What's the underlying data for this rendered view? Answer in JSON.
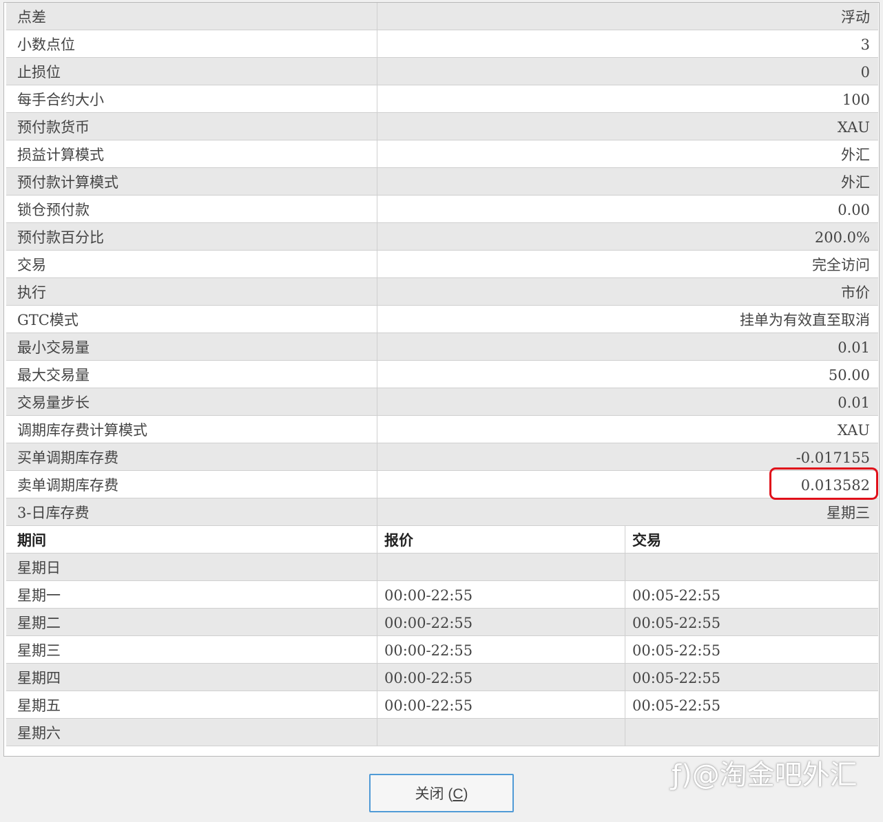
{
  "spec_rows": [
    {
      "label": "点差",
      "value": "浮动"
    },
    {
      "label": "小数点位",
      "value": "3"
    },
    {
      "label": "止损位",
      "value": "0"
    },
    {
      "label": "每手合约大小",
      "value": "100"
    },
    {
      "label": "预付款货币",
      "value": "XAU"
    },
    {
      "label": "损益计算模式",
      "value": "外汇"
    },
    {
      "label": "预付款计算模式",
      "value": "外汇"
    },
    {
      "label": "锁仓预付款",
      "value": "0.00"
    },
    {
      "label": "预付款百分比",
      "value": "200.0%"
    },
    {
      "label": "交易",
      "value": "完全访问"
    },
    {
      "label": "执行",
      "value": "市价"
    },
    {
      "label": "GTC模式",
      "value": "挂单为有效直至取消"
    },
    {
      "label": "最小交易量",
      "value": "0.01"
    },
    {
      "label": "最大交易量",
      "value": "50.00"
    },
    {
      "label": "交易量步长",
      "value": "0.01"
    },
    {
      "label": "调期库存费计算模式",
      "value": "XAU"
    },
    {
      "label": "买单调期库存费",
      "value": "-0.017155"
    },
    {
      "label": "卖单调期库存费",
      "value": "0.013582"
    },
    {
      "label": "3-日库存费",
      "value": "星期三"
    }
  ],
  "sessions": {
    "headers": {
      "period": "期间",
      "quote": "报价",
      "trade": "交易"
    },
    "rows": [
      {
        "day": "星期日",
        "quote": "",
        "trade": ""
      },
      {
        "day": "星期一",
        "quote": "00:00-22:55",
        "trade": "00:05-22:55"
      },
      {
        "day": "星期二",
        "quote": "00:00-22:55",
        "trade": "00:05-22:55"
      },
      {
        "day": "星期三",
        "quote": "00:00-22:55",
        "trade": "00:05-22:55"
      },
      {
        "day": "星期四",
        "quote": "00:00-22:55",
        "trade": "00:05-22:55"
      },
      {
        "day": "星期五",
        "quote": "00:00-22:55",
        "trade": "00:05-22:55"
      },
      {
        "day": "星期六",
        "quote": "",
        "trade": ""
      }
    ]
  },
  "buttons": {
    "close_prefix": "关闭 (",
    "close_hotkey": "C",
    "close_suffix": ")"
  },
  "watermark": "@淘金吧外汇",
  "colors": {
    "highlight": "#e0101a",
    "button_border": "#4f9ad6",
    "row_gray": "#e8e8e8"
  }
}
